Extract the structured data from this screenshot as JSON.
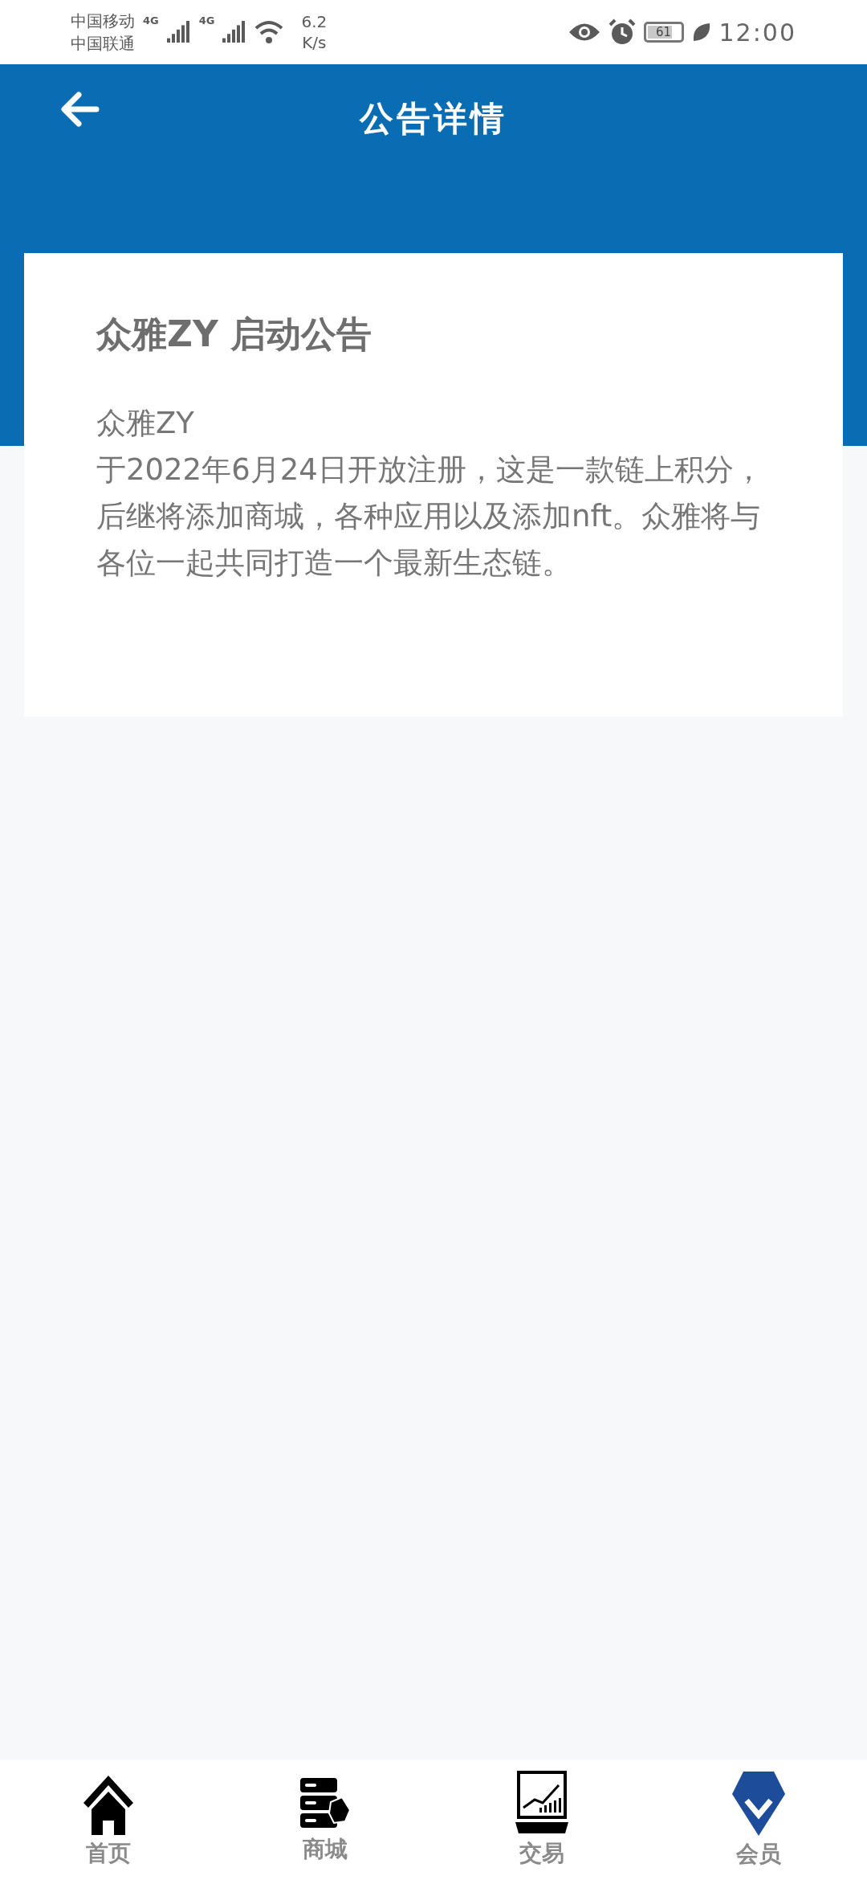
{
  "status_bar": {
    "carriers": [
      "中国移动",
      "中国联通"
    ],
    "network_tags": [
      "4G",
      "4G"
    ],
    "speed": [
      "6.2",
      "K/s"
    ],
    "battery": "61",
    "time": "12:00"
  },
  "header": {
    "title": "公告详情"
  },
  "notice": {
    "title": "众雅ZY 启动公告",
    "lines": [
      "众雅ZY",
      "于2022年6月24日开放注册，这是一款链上积分，后继将添加商城，各种应用以及添加nft。众雅将与各位一起共同打造一个最新生态链。"
    ]
  },
  "tab_bar": [
    {
      "kind": "home",
      "label": "首页"
    },
    {
      "kind": "shop",
      "label": "商城"
    },
    {
      "kind": "trade",
      "label": "交易"
    },
    {
      "kind": "member",
      "label": "会员"
    }
  ]
}
